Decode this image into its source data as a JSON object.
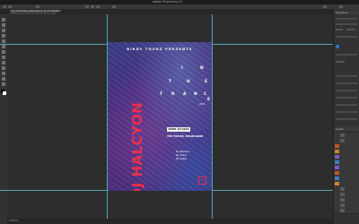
{
  "app": {
    "title": "Adobe Photoshop CC"
  },
  "doc_tab": {
    "label": "DJ_HALCYON_poster.psd @ 16.7% (RGB/8)",
    "close": "×"
  },
  "status": {
    "zoom": "16.67%"
  },
  "poster": {
    "presents": "BIRDY TOURS PRESENTS",
    "vertical_letters": [
      "I",
      "N",
      "T",
      "H",
      "E",
      "T",
      "R",
      "A",
      "N",
      "C",
      "E"
    ],
    "year": "2019",
    "title": "DJ HALCYON",
    "date": "APRIL 25 2019",
    "venue": "THE FORUM, MELBOURNE",
    "lineup": [
      "DJ Zakaroo",
      "DJ Cherz",
      "DJ Gabel"
    ],
    "logo": "N"
  },
  "panels": {
    "properties": "Properties",
    "layers": "Layers",
    "layer_colors": [
      "#c0522a",
      "#c8852c",
      "#7a5ac0",
      "#3f7fc4",
      "#7a5ac0",
      "#c0522a",
      "#3f7fc4",
      "#c8852c"
    ]
  },
  "colors": {
    "accent": "#e8304e",
    "guide": "#4aa9b3"
  }
}
